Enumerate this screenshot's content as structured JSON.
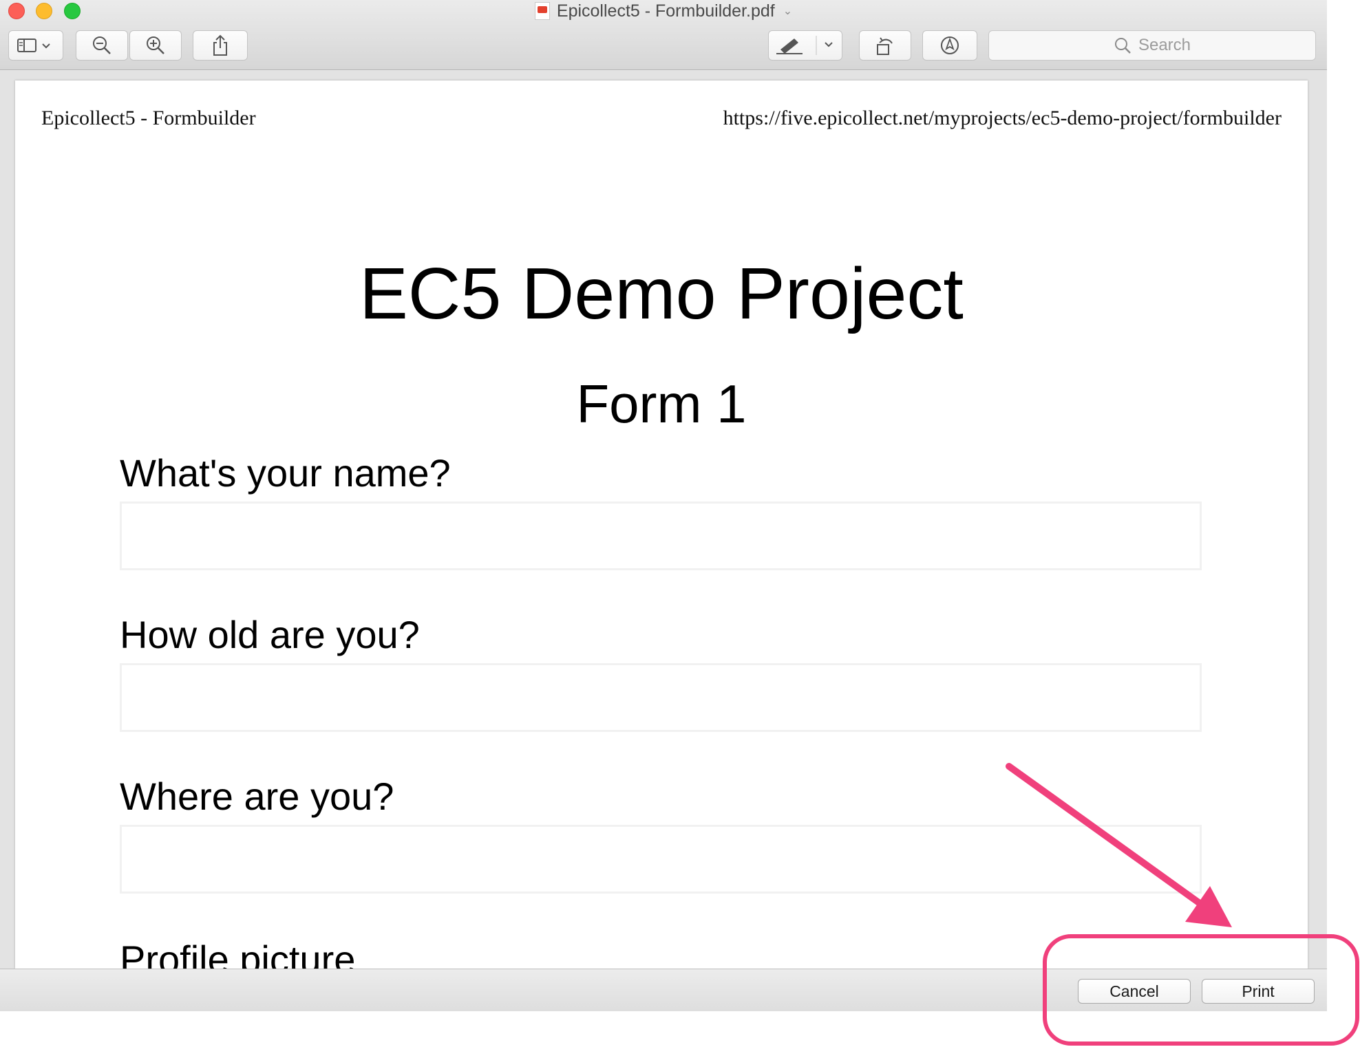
{
  "window": {
    "title": "Epicollect5 - Formbuilder.pdf"
  },
  "toolbar": {
    "search_placeholder": "Search",
    "icons": [
      "sidebar-icon",
      "zoom-out-icon",
      "zoom-in-icon",
      "share-icon",
      "highlighter-icon",
      "rotate-icon",
      "markup-icon",
      "search-icon"
    ]
  },
  "document": {
    "header_left": "Epicollect5 - Formbuilder",
    "header_right": "https://five.epicollect.net/myprojects/ec5-demo-project/formbuilder",
    "title": "EC5 Demo Project",
    "form_title": "Form 1",
    "questions": [
      {
        "label": "What's your name?"
      },
      {
        "label": "How old are you?"
      },
      {
        "label": "Where are you?"
      },
      {
        "label": "Profile picture"
      }
    ]
  },
  "bottom_bar": {
    "cancel_label": "Cancel",
    "print_label": "Print"
  },
  "annotation": {
    "color": "#f0407c"
  }
}
